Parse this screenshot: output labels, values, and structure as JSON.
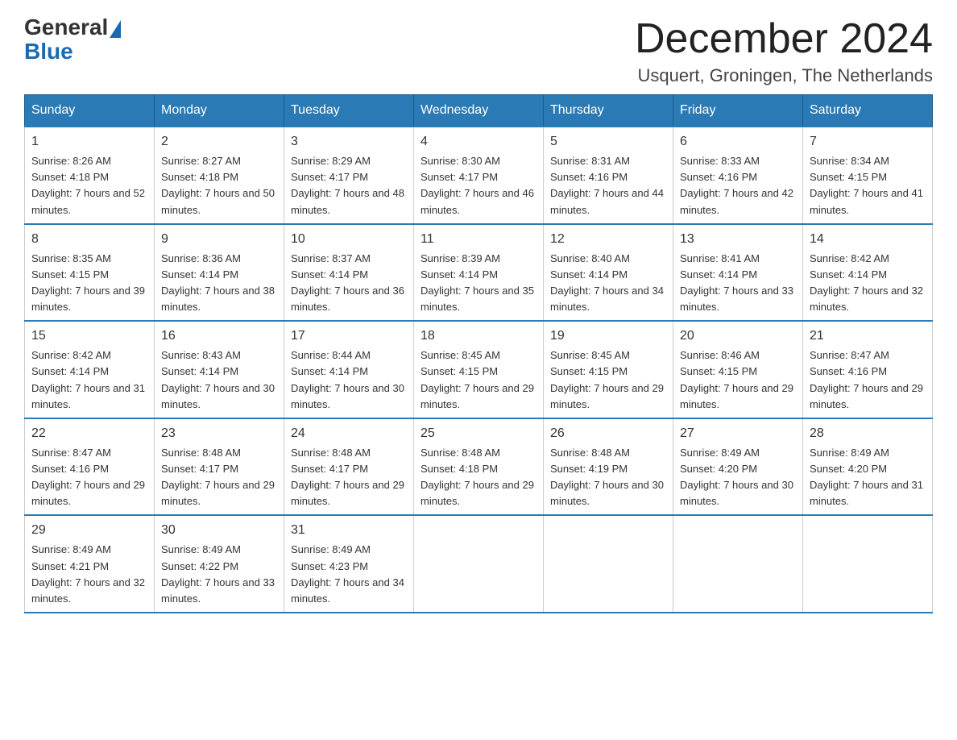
{
  "header": {
    "logo_general": "General",
    "logo_blue": "Blue",
    "title": "December 2024",
    "subtitle": "Usquert, Groningen, The Netherlands"
  },
  "weekdays": [
    "Sunday",
    "Monday",
    "Tuesday",
    "Wednesday",
    "Thursday",
    "Friday",
    "Saturday"
  ],
  "weeks": [
    [
      {
        "day": "1",
        "sunrise": "8:26 AM",
        "sunset": "4:18 PM",
        "daylight": "7 hours and 52 minutes."
      },
      {
        "day": "2",
        "sunrise": "8:27 AM",
        "sunset": "4:18 PM",
        "daylight": "7 hours and 50 minutes."
      },
      {
        "day": "3",
        "sunrise": "8:29 AM",
        "sunset": "4:17 PM",
        "daylight": "7 hours and 48 minutes."
      },
      {
        "day": "4",
        "sunrise": "8:30 AM",
        "sunset": "4:17 PM",
        "daylight": "7 hours and 46 minutes."
      },
      {
        "day": "5",
        "sunrise": "8:31 AM",
        "sunset": "4:16 PM",
        "daylight": "7 hours and 44 minutes."
      },
      {
        "day": "6",
        "sunrise": "8:33 AM",
        "sunset": "4:16 PM",
        "daylight": "7 hours and 42 minutes."
      },
      {
        "day": "7",
        "sunrise": "8:34 AM",
        "sunset": "4:15 PM",
        "daylight": "7 hours and 41 minutes."
      }
    ],
    [
      {
        "day": "8",
        "sunrise": "8:35 AM",
        "sunset": "4:15 PM",
        "daylight": "7 hours and 39 minutes."
      },
      {
        "day": "9",
        "sunrise": "8:36 AM",
        "sunset": "4:14 PM",
        "daylight": "7 hours and 38 minutes."
      },
      {
        "day": "10",
        "sunrise": "8:37 AM",
        "sunset": "4:14 PM",
        "daylight": "7 hours and 36 minutes."
      },
      {
        "day": "11",
        "sunrise": "8:39 AM",
        "sunset": "4:14 PM",
        "daylight": "7 hours and 35 minutes."
      },
      {
        "day": "12",
        "sunrise": "8:40 AM",
        "sunset": "4:14 PM",
        "daylight": "7 hours and 34 minutes."
      },
      {
        "day": "13",
        "sunrise": "8:41 AM",
        "sunset": "4:14 PM",
        "daylight": "7 hours and 33 minutes."
      },
      {
        "day": "14",
        "sunrise": "8:42 AM",
        "sunset": "4:14 PM",
        "daylight": "7 hours and 32 minutes."
      }
    ],
    [
      {
        "day": "15",
        "sunrise": "8:42 AM",
        "sunset": "4:14 PM",
        "daylight": "7 hours and 31 minutes."
      },
      {
        "day": "16",
        "sunrise": "8:43 AM",
        "sunset": "4:14 PM",
        "daylight": "7 hours and 30 minutes."
      },
      {
        "day": "17",
        "sunrise": "8:44 AM",
        "sunset": "4:14 PM",
        "daylight": "7 hours and 30 minutes."
      },
      {
        "day": "18",
        "sunrise": "8:45 AM",
        "sunset": "4:15 PM",
        "daylight": "7 hours and 29 minutes."
      },
      {
        "day": "19",
        "sunrise": "8:45 AM",
        "sunset": "4:15 PM",
        "daylight": "7 hours and 29 minutes."
      },
      {
        "day": "20",
        "sunrise": "8:46 AM",
        "sunset": "4:15 PM",
        "daylight": "7 hours and 29 minutes."
      },
      {
        "day": "21",
        "sunrise": "8:47 AM",
        "sunset": "4:16 PM",
        "daylight": "7 hours and 29 minutes."
      }
    ],
    [
      {
        "day": "22",
        "sunrise": "8:47 AM",
        "sunset": "4:16 PM",
        "daylight": "7 hours and 29 minutes."
      },
      {
        "day": "23",
        "sunrise": "8:48 AM",
        "sunset": "4:17 PM",
        "daylight": "7 hours and 29 minutes."
      },
      {
        "day": "24",
        "sunrise": "8:48 AM",
        "sunset": "4:17 PM",
        "daylight": "7 hours and 29 minutes."
      },
      {
        "day": "25",
        "sunrise": "8:48 AM",
        "sunset": "4:18 PM",
        "daylight": "7 hours and 29 minutes."
      },
      {
        "day": "26",
        "sunrise": "8:48 AM",
        "sunset": "4:19 PM",
        "daylight": "7 hours and 30 minutes."
      },
      {
        "day": "27",
        "sunrise": "8:49 AM",
        "sunset": "4:20 PM",
        "daylight": "7 hours and 30 minutes."
      },
      {
        "day": "28",
        "sunrise": "8:49 AM",
        "sunset": "4:20 PM",
        "daylight": "7 hours and 31 minutes."
      }
    ],
    [
      {
        "day": "29",
        "sunrise": "8:49 AM",
        "sunset": "4:21 PM",
        "daylight": "7 hours and 32 minutes."
      },
      {
        "day": "30",
        "sunrise": "8:49 AM",
        "sunset": "4:22 PM",
        "daylight": "7 hours and 33 minutes."
      },
      {
        "day": "31",
        "sunrise": "8:49 AM",
        "sunset": "4:23 PM",
        "daylight": "7 hours and 34 minutes."
      },
      null,
      null,
      null,
      null
    ]
  ]
}
